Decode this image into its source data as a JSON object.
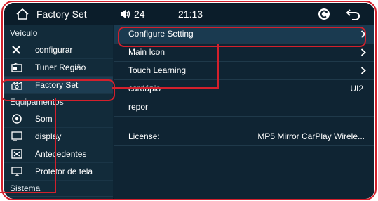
{
  "header": {
    "title": "Factory Set",
    "volume": "24",
    "time": "21:13"
  },
  "sidebar": {
    "sections": [
      {
        "label": "Veículo",
        "items": [
          {
            "label": "configurar",
            "icon": "wrench-screwdriver-icon"
          },
          {
            "label": "Tuner Região",
            "icon": "radio-icon"
          },
          {
            "label": "Factory Set",
            "icon": "factory-icon",
            "selected": true
          }
        ]
      },
      {
        "label": "Equipamentos",
        "items": [
          {
            "label": "Som",
            "icon": "speaker-icon"
          },
          {
            "label": "display",
            "icon": "display-icon"
          },
          {
            "label": "Antecedentes",
            "icon": "image-icon"
          },
          {
            "label": "Protetor de tela",
            "icon": "monitor-icon"
          }
        ]
      },
      {
        "label": "Sistema",
        "items": []
      }
    ]
  },
  "main": {
    "rows": [
      {
        "label": "Configure Setting",
        "chevron": true,
        "highlight": true
      },
      {
        "label": "Main Icon",
        "chevron": true
      },
      {
        "label": "Touch Learning",
        "chevron": true
      },
      {
        "label": "cardápio",
        "value": "UI2"
      },
      {
        "label": "repor"
      }
    ],
    "license": {
      "label": "License:",
      "value": "MP5 Mirror CarPlay Wirele..."
    }
  },
  "annotation": {
    "color": "#d3202c"
  }
}
